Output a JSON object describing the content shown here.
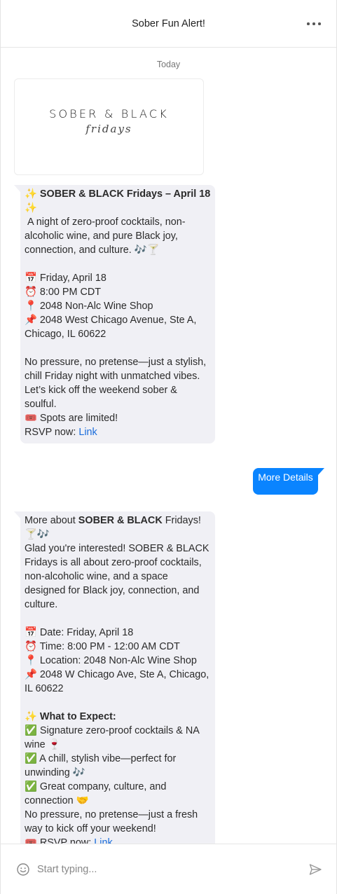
{
  "header": {
    "title": "Sober Fun Alert!",
    "more_icon": "more-horizontal-icon"
  },
  "thread": {
    "date_label": "Today",
    "logo": {
      "line1": "SOBER & BLACK",
      "line2": "fridays"
    },
    "message1": {
      "title_prefix": "✨ ",
      "title_bold": "SOBER & BLACK Fridays – April 18",
      "title_suffix": " ✨",
      "intro": " A night of zero-proof cocktails, non-alcoholic wine, and pure Black joy, connection, and culture. 🎶🍸",
      "date": "📅 Friday, April 18",
      "time": "⏰ 8:00 PM CDT",
      "venue": "📍 2048 Non-Alc Wine Shop",
      "address": "📌 2048 West Chicago Avenue, Ste A, Chicago, IL 60622",
      "body": "No pressure, no pretense—just a stylish, chill Friday night with unmatched vibes. Let’s kick off the weekend sober & soulful.",
      "spots": "🎟️ Spots are limited!",
      "rsvp_prefix": "RSVP now: ",
      "rsvp_link": "Link"
    },
    "outgoing": {
      "label": "More Details"
    },
    "message2": {
      "line1_prefix": "More about ",
      "line1_bold": "SOBER & BLACK",
      "line1_suffix": " Fridays! 🍸🎶",
      "intro": "Glad you're interested! SOBER & BLACK Fridays is all about zero-proof cocktails, non-alcoholic wine, and a space designed for Black joy, connection, and culture.",
      "date": "📅 Date: Friday, April 18",
      "time": "⏰ Time: 8:00 PM - 12:00 AM CDT",
      "location": "📍 Location: 2048 Non-Alc Wine Shop",
      "address": "📌 2048 W Chicago Ave, Ste A, Chicago, IL 60622",
      "expect_prefix": "✨ ",
      "expect_bold": "What to Expect:",
      "item1": "✅ Signature zero-proof cocktails & NA wine 🍷",
      "item2": "✅ A chill, stylish vibe—perfect for unwinding 🎶",
      "item3": "✅ Great company, culture, and connection 🤝",
      "closing": "No pressure, no pretense—just a fresh way to kick off your weekend!",
      "rsvp_prefix": "🎟️ RSVP now: ",
      "rsvp_link": "Link"
    }
  },
  "composer": {
    "placeholder": "Start typing...",
    "emoji_icon": "smiley-icon",
    "send_icon": "send-icon"
  }
}
